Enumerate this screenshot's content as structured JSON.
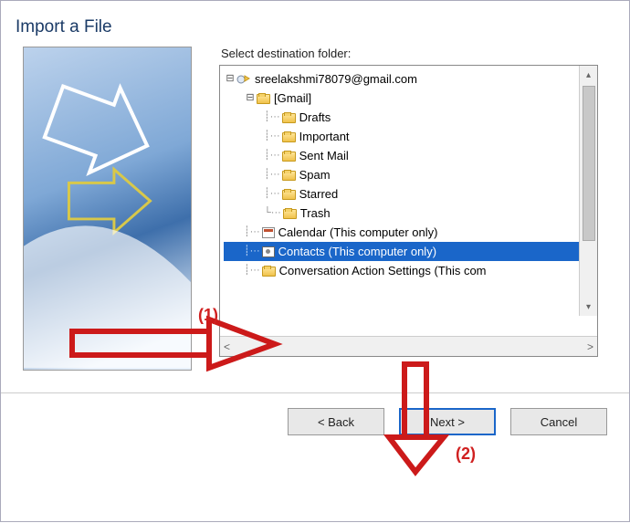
{
  "dialog": {
    "title": "Import a File"
  },
  "label": "Select destination folder:",
  "tree": {
    "account": "sreelakshmi78079@gmail.com",
    "gmail_label": "[Gmail]",
    "folders": [
      "Drafts",
      "Important",
      "Sent Mail",
      "Spam",
      "Starred",
      "Trash"
    ],
    "calendar": "Calendar (This computer only)",
    "contacts": "Contacts (This computer only)",
    "conversation": "Conversation Action Settings (This com"
  },
  "buttons": {
    "back": "< Back",
    "next": "Next >",
    "cancel": "Cancel"
  },
  "annotations": {
    "one": "(1)",
    "two": "(2)"
  }
}
